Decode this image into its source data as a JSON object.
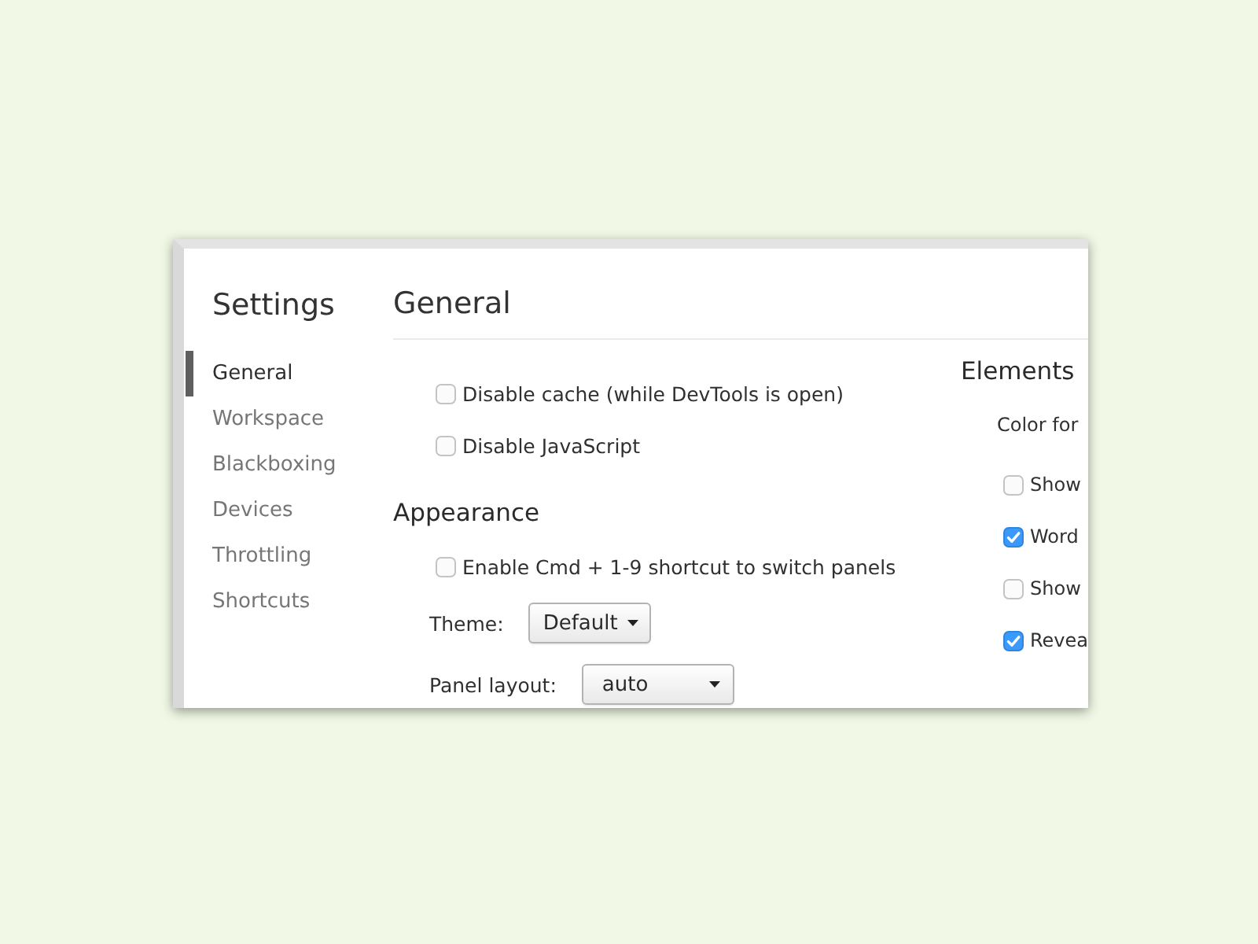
{
  "window": {
    "title": "Settings"
  },
  "sidebar": {
    "items": [
      {
        "label": "General",
        "selected": true
      },
      {
        "label": "Workspace",
        "selected": false
      },
      {
        "label": "Blackboxing",
        "selected": false
      },
      {
        "label": "Devices",
        "selected": false
      },
      {
        "label": "Throttling",
        "selected": false
      },
      {
        "label": "Shortcuts",
        "selected": false
      }
    ]
  },
  "page": {
    "title": "General"
  },
  "columns": [
    {
      "sections": [
        {
          "items": [
            {
              "kind": "checkbox",
              "label": "Disable cache (while DevTools is open)",
              "checked": false
            },
            {
              "kind": "checkbox",
              "label": "Disable JavaScript",
              "checked": false
            }
          ]
        },
        {
          "heading": "Appearance",
          "items": [
            {
              "kind": "checkbox",
              "label": "Enable Cmd + 1-9 shortcut to switch panels",
              "checked": false
            },
            {
              "kind": "select",
              "label": "Theme:",
              "value": "Default"
            },
            {
              "kind": "select",
              "label": "Panel layout:",
              "value": "auto"
            }
          ]
        }
      ]
    },
    {
      "sections": [
        {
          "heading": "Elements",
          "items": [
            {
              "kind": "label",
              "label": "Color for"
            },
            {
              "kind": "checkbox",
              "label": "Show",
              "checked": false
            },
            {
              "kind": "checkbox",
              "label": "Word",
              "checked": true
            },
            {
              "kind": "checkbox",
              "label": "Show",
              "checked": false
            },
            {
              "kind": "checkbox",
              "label": "Revea",
              "checked": true
            }
          ]
        }
      ]
    }
  ]
}
